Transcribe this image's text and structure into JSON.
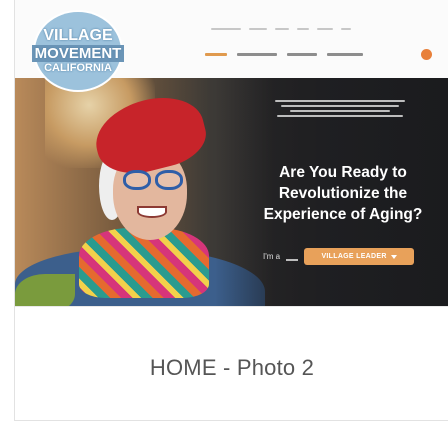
{
  "logo": {
    "line1": "VILLAGE",
    "line2": "MOVEMENT",
    "line3": "CALIFORNIA"
  },
  "hero": {
    "headline_line1": "Are You Ready to",
    "headline_line2": "Revolutionize the",
    "headline_line3": "Experience of Aging?",
    "cta_prefix": "I'm a",
    "cta_select": "VILLAGE LEADER"
  },
  "caption": "HOME - Photo 2",
  "colors": {
    "accent_orange": "#e8a15a",
    "logo_blue": "#9cc2dc",
    "caption_gray": "#555555"
  }
}
